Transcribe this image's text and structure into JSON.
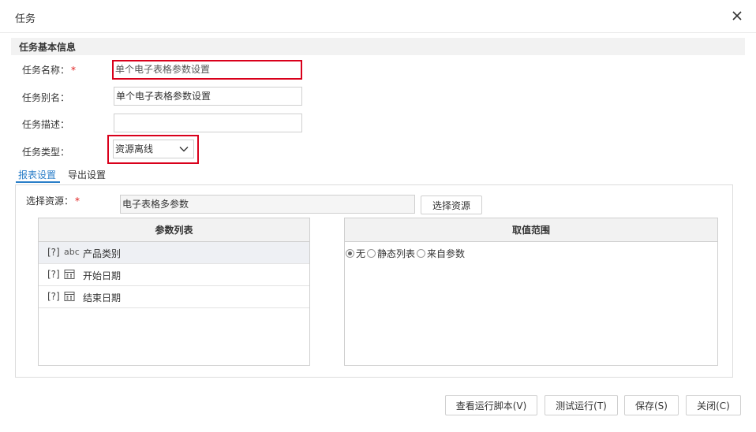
{
  "dialog": {
    "title": "任务"
  },
  "section": {
    "title": "任务基本信息"
  },
  "form": {
    "name_label": "任务名称：",
    "name_value": "单个电子表格参数设置",
    "alias_label": "任务别名：",
    "alias_value": "单个电子表格参数设置",
    "desc_label": "任务描述：",
    "desc_value": "",
    "type_label": "任务类型：",
    "type_value": "资源离线",
    "required_mark": "*"
  },
  "tabs": [
    {
      "label": "报表设置",
      "active": true
    },
    {
      "label": "导出设置",
      "active": false
    }
  ],
  "resource": {
    "label": "选择资源：",
    "value": "电子表格多参数",
    "button": "选择资源"
  },
  "params": {
    "header": "参数列表",
    "rows": [
      {
        "q": "[?]",
        "type_icon": "abc",
        "label": "产品类别"
      },
      {
        "q": "[?]",
        "type_icon": "calendar-icon",
        "label": "开始日期"
      },
      {
        "q": "[?]",
        "type_icon": "calendar-icon",
        "label": "结束日期"
      }
    ]
  },
  "range": {
    "header": "取值范围",
    "options": [
      {
        "label": "无",
        "checked": true
      },
      {
        "label": "静态列表",
        "checked": false
      },
      {
        "label": "来自参数",
        "checked": false
      }
    ]
  },
  "footer": {
    "view_script": "查看运行脚本(V)",
    "test_run": "测试运行(T)",
    "save": "保存(S)",
    "close": "关闭(C)"
  },
  "colors": {
    "accent": "#2a7ec8",
    "highlight": "#d9001b",
    "required": "#e02020"
  }
}
